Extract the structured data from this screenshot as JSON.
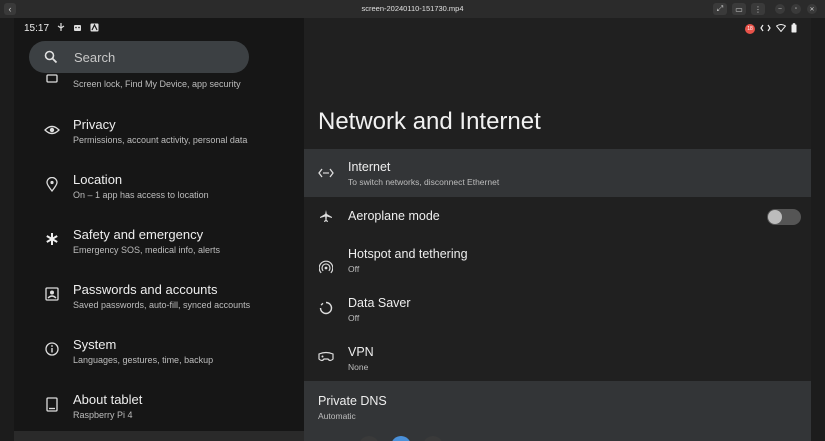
{
  "window": {
    "title": "screen-20240110-151730.mp4",
    "back_glyph": "‹",
    "buttons": [
      "⤢",
      "▭",
      "⋮"
    ],
    "controls": [
      "–",
      "▫",
      "✕"
    ]
  },
  "status": {
    "time": "15:17",
    "notification_count": "18"
  },
  "search": {
    "placeholder": "Search"
  },
  "sidebar": {
    "items": [
      {
        "title": "",
        "subtitle": "Screen lock, Find My Device, app security",
        "icon": "security-icon"
      },
      {
        "title": "Privacy",
        "subtitle": "Permissions, account activity, personal data",
        "icon": "privacy-eye-icon"
      },
      {
        "title": "Location",
        "subtitle": "On – 1 app has access to location",
        "icon": "location-pin-icon"
      },
      {
        "title": "Safety and emergency",
        "subtitle": "Emergency SOS, medical info, alerts",
        "icon": "asterisk-icon"
      },
      {
        "title": "Passwords and accounts",
        "subtitle": "Saved passwords, auto-fill, synced accounts",
        "icon": "account-box-icon"
      },
      {
        "title": "System",
        "subtitle": "Languages, gestures, time, backup",
        "icon": "info-icon"
      },
      {
        "title": "About tablet",
        "subtitle": "Raspberry Pi 4",
        "icon": "tablet-icon"
      }
    ]
  },
  "main": {
    "title": "Network and Internet",
    "rows": [
      {
        "title": "Internet",
        "subtitle": "To switch networks, disconnect Ethernet",
        "icon": "ethernet-icon"
      },
      {
        "title": "Aeroplane mode",
        "subtitle": "",
        "icon": "airplane-icon"
      },
      {
        "title": "Hotspot and tethering",
        "subtitle": "Off",
        "icon": "hotspot-icon"
      },
      {
        "title": "Data Saver",
        "subtitle": "Off",
        "icon": "data-saver-icon"
      },
      {
        "title": "VPN",
        "subtitle": "None",
        "icon": "vpn-key-icon"
      }
    ],
    "private_dns": {
      "title": "Private DNS",
      "subtitle": "Automatic"
    },
    "aeroplane_mode_enabled": false
  },
  "colors": {
    "left_pane": "#161616",
    "right_pane": "#202020",
    "highlight": "#333537",
    "search_bg": "#3c4043",
    "badge": "#e8534a"
  }
}
